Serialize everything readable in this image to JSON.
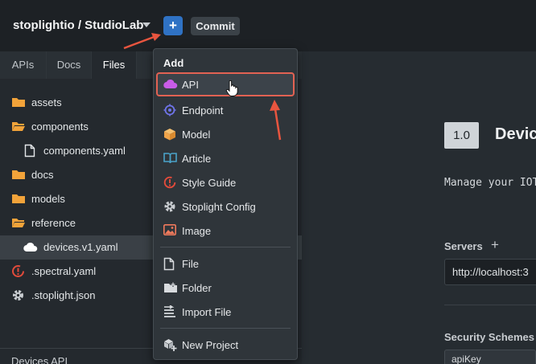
{
  "topbar": {
    "workspace": "stoplightio / StudioLab",
    "add_button": "+",
    "commit_button": "Commit"
  },
  "sidebar": {
    "tabs": [
      {
        "label": "APIs"
      },
      {
        "label": "Docs"
      },
      {
        "label": "Files"
      }
    ],
    "active_tab": "Files",
    "tree": [
      {
        "label": "assets",
        "icon": "folder-icon"
      },
      {
        "label": "components",
        "icon": "folder-open-icon"
      },
      {
        "label": "components.yaml",
        "icon": "file-icon"
      },
      {
        "label": "docs",
        "icon": "folder-icon"
      },
      {
        "label": "models",
        "icon": "folder-icon"
      },
      {
        "label": "reference",
        "icon": "folder-open-icon"
      },
      {
        "label": "devices.v1.yaml",
        "icon": "cloud-icon",
        "selected": true
      },
      {
        "label": ".spectral.yaml",
        "icon": "style-guide-icon"
      },
      {
        "label": ".stoplight.json",
        "icon": "gear-icon"
      }
    ],
    "footer": "Devices API"
  },
  "main": {
    "version": "1.0",
    "title": "Devic",
    "description": "Manage your IOT",
    "servers_label": "Servers",
    "servers_add": "+",
    "server_url": "http://localhost:3",
    "security_label": "Security Schemes",
    "security_value": "apiKey"
  },
  "menu": {
    "header": "Add",
    "items": [
      {
        "label": "API",
        "icon": "cloud-icon",
        "highlighted": true
      },
      {
        "label": "Endpoint",
        "icon": "crosshair-icon"
      },
      {
        "label": "Model",
        "icon": "cube-icon"
      },
      {
        "label": "Article",
        "icon": "book-icon"
      },
      {
        "label": "Style Guide",
        "icon": "style-guide-icon"
      },
      {
        "label": "Stoplight Config",
        "icon": "gear-icon"
      },
      {
        "label": "Image",
        "icon": "image-icon"
      },
      {
        "label": "File",
        "icon": "file-icon"
      },
      {
        "label": "Folder",
        "icon": "folder-plus-icon"
      },
      {
        "label": "Import File",
        "icon": "import-icon"
      },
      {
        "label": "New Project",
        "icon": "new-project-icon"
      }
    ]
  },
  "colors": {
    "accent": "#2f72c4",
    "folder": "#f2a33a",
    "highlight_border": "#e26253",
    "api_cloud": "#c95ce8",
    "endpoint": "#6f74ea",
    "model": "#f0a44a",
    "article": "#4aa3c9",
    "style_guide": "#e24b3b"
  }
}
